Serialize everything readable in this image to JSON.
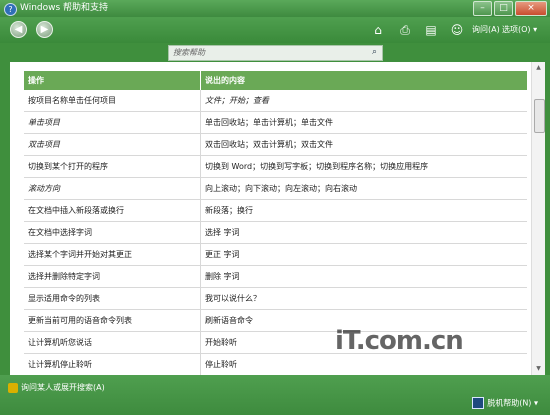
{
  "window": {
    "title": "Windows 帮助和支持"
  },
  "toolbar": {
    "ask_label": "询问(A)",
    "options_label": "选项(O) ▾"
  },
  "search": {
    "placeholder": "搜索帮助"
  },
  "table": {
    "headers": {
      "action": "操作",
      "say": "说出的内容"
    },
    "rows": [
      {
        "action": "按项目名称单击任何项目",
        "say": "文件；开始；查看"
      },
      {
        "action": "单击项目",
        "say": "单击回收站；单击计算机；单击文件"
      },
      {
        "action": "双击项目",
        "say": "双击回收站；双击计算机；双击文件"
      },
      {
        "action": "切换到某个打开的程序",
        "say": "切换到 Word；切换到写字板；切换到程序名称；切换应用程序"
      },
      {
        "action": "滚动方向",
        "say": "向上滚动；向下滚动；向左滚动；向右滚动"
      },
      {
        "action": "在文档中插入新段落或换行",
        "say": "新段落；换行"
      },
      {
        "action": "在文档中选择字词",
        "say": "选择 字词"
      },
      {
        "action": "选择某个字词并开始对其更正",
        "say": "更正 字词"
      },
      {
        "action": "选择并删除特定字词",
        "say": "删除 字词"
      },
      {
        "action": "显示适用命令的列表",
        "say": "我可以说什么？"
      },
      {
        "action": "更新当前可用的语音命令列表",
        "say": "刷新语音命令"
      },
      {
        "action": "让计算机听您说话",
        "say": "开始聆听"
      },
      {
        "action": "让计算机停止聆听",
        "say": "停止聆听"
      }
    ]
  },
  "status": {
    "left_label": "询问某人或展开搜索(A)",
    "right_label": "脱机帮助(N) ▾"
  },
  "watermark": {
    "text": "iT.com.cn"
  }
}
